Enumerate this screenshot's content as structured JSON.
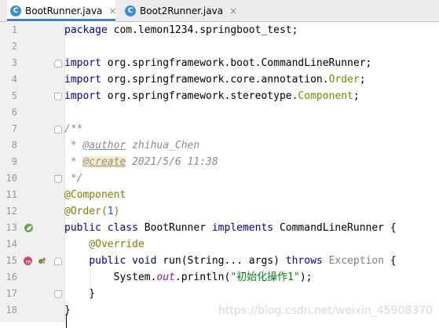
{
  "tabs": [
    {
      "label": "BootRunner.java",
      "icon_letter": "C",
      "active": true
    },
    {
      "label": "Boot2Runner.java",
      "icon_letter": "C",
      "active": false
    }
  ],
  "close_glyph": "×",
  "line_numbers": [
    "1",
    "2",
    "3",
    "4",
    "5",
    "6",
    "7",
    "8",
    "9",
    "10",
    "11",
    "12",
    "13",
    "14",
    "15",
    "16",
    "17",
    "18"
  ],
  "code": {
    "l1": {
      "kw": "package",
      "rest": " com.lemon1234.springboot_test;"
    },
    "l3": {
      "kw": "import",
      "rest": " org.springframework.boot.CommandLineRunner;"
    },
    "l4": {
      "kw": "import",
      "rest": " org.springframework.core.annotation.",
      "cls": "Order",
      "end": ";"
    },
    "l5": {
      "kw": "import",
      "rest": " org.springframework.stereotype.",
      "cls": "Component",
      "end": ";"
    },
    "l7": {
      "text": "/**"
    },
    "l8": {
      "star": " * ",
      "tag": "@author",
      "val": " zhihua_Chen"
    },
    "l9": {
      "star": " * ",
      "tag": "@create",
      "val": " 2021/5/6 11:38"
    },
    "l10": {
      "text": " */"
    },
    "l11": {
      "ann": "@Component"
    },
    "l12": {
      "ann": "@Order(",
      "num": "1",
      "close": ")"
    },
    "l13": {
      "kw1": "public class",
      "name": " BootRunner ",
      "kw2": "implements",
      "rest": " CommandLineRunner {"
    },
    "l14": {
      "ann": "    @Override"
    },
    "l15": {
      "indent": "    ",
      "kw1": "public void",
      "name": " run(String... args) ",
      "kw2": "throws",
      "exc": " Exception",
      "end": " {"
    },
    "l16": {
      "pre": "        System.",
      "field": "out",
      "mid": ".println(",
      "str": "\"初始化操作1\"",
      "end": ");"
    },
    "l17": {
      "text": "    }"
    },
    "l18": {
      "text": "}"
    }
  },
  "gutter_icons": {
    "line13": "spring-bean-icon",
    "line15_a": "override-method-icon",
    "line15_b": "implements-method-icon"
  },
  "watermark": "https://blog.csdn.net/weixin_45908370",
  "colors": {
    "keyword": "#00008b",
    "annotation": "#808000",
    "comment": "#8c8c8c",
    "string": "#067d17",
    "number": "#1750eb",
    "tab_active_underline": "#4083c9"
  }
}
